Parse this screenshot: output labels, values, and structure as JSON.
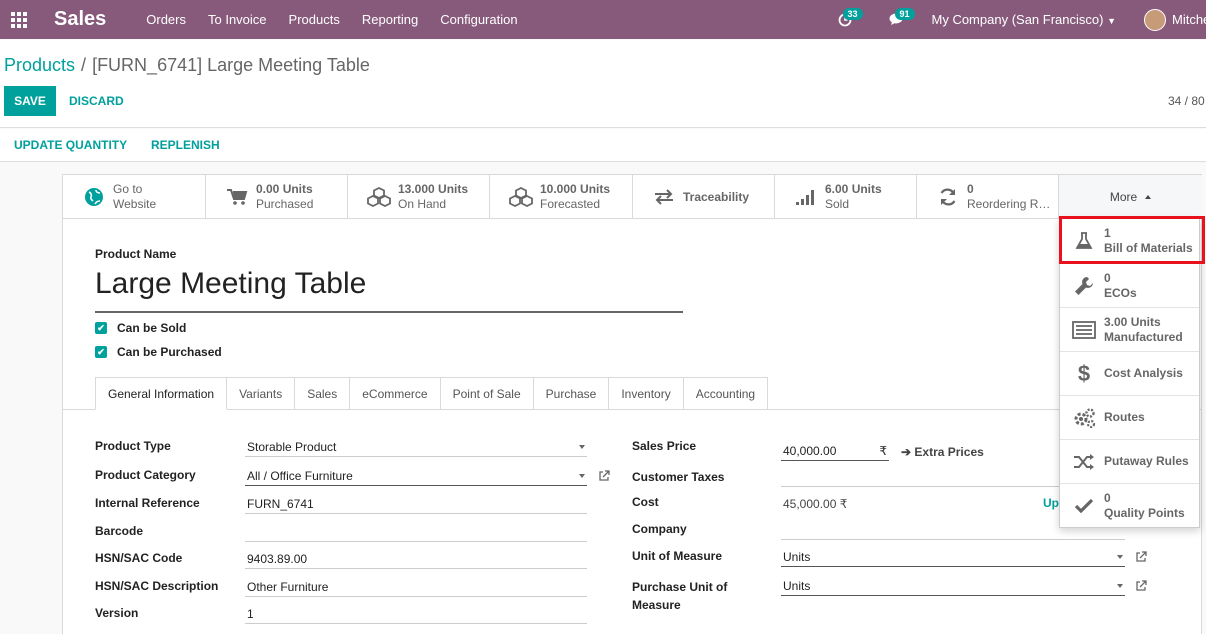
{
  "navbar": {
    "app_name": "Sales",
    "menu": [
      "Orders",
      "To Invoice",
      "Products",
      "Reporting",
      "Configuration"
    ],
    "activity_count": "33",
    "message_count": "91",
    "company": "My Company (San Francisco)",
    "user": "Mitchell Admin",
    "bg_color": "#875a7b"
  },
  "breadcrumb": {
    "parent": "Products",
    "separator": "/",
    "current": "[FURN_6741] Large Meeting Table"
  },
  "actions": {
    "save": "SAVE",
    "discard": "DISCARD",
    "pager": "34 / 80"
  },
  "status_buttons": {
    "update_quantity": "UPDATE QUANTITY",
    "replenish": "REPLENISH"
  },
  "smart_buttons": [
    {
      "line1": "Go to",
      "line2": "Website",
      "icon": "globe-icon"
    },
    {
      "line1": "0.00 Units",
      "line2": "Purchased",
      "icon": "cart-icon"
    },
    {
      "line1": "13.000 Units",
      "line2": "On Hand",
      "icon": "cubes-icon"
    },
    {
      "line1": "10.000 Units",
      "line2": "Forecasted",
      "icon": "cubes-icon"
    },
    {
      "line1": "Traceability",
      "line2": "",
      "icon": "arrows-icon"
    },
    {
      "line1": "6.00 Units",
      "line2": "Sold",
      "icon": "signal-icon"
    },
    {
      "line1": "0",
      "line2": "Reordering Rules",
      "icon": "refresh-icon"
    }
  ],
  "more_label": "More",
  "more_menu": [
    {
      "line1": "1",
      "line2": "Bill of Materials",
      "icon": "flask-icon"
    },
    {
      "line1": "0",
      "line2": "ECOs",
      "icon": "wrench-icon"
    },
    {
      "line1": "3.00 Units",
      "line2": "Manufactured",
      "icon": "list-icon"
    },
    {
      "line1": "Cost Analysis",
      "line2": "",
      "icon": "dollar-icon"
    },
    {
      "line1": "Routes",
      "line2": "",
      "icon": "cogs-icon"
    },
    {
      "line1": "Putaway Rules",
      "line2": "",
      "icon": "random-icon"
    },
    {
      "line1": "0",
      "line2": "Quality Points",
      "icon": "check-icon"
    }
  ],
  "product": {
    "name_label": "Product Name",
    "name": "Large Meeting Table",
    "can_be_sold": "Can be Sold",
    "can_be_purchased": "Can be Purchased"
  },
  "tabs": [
    "General Information",
    "Variants",
    "Sales",
    "eCommerce",
    "Point of Sale",
    "Purchase",
    "Inventory",
    "Accounting"
  ],
  "left_fields": {
    "product_type": {
      "label": "Product Type",
      "value": "Storable Product"
    },
    "product_category": {
      "label": "Product Category",
      "value": "All / Office Furniture"
    },
    "internal_reference": {
      "label": "Internal Reference",
      "value": "FURN_6741"
    },
    "barcode": {
      "label": "Barcode",
      "value": ""
    },
    "hsn_code": {
      "label": "HSN/SAC Code",
      "value": "9403.89.00"
    },
    "hsn_desc": {
      "label": "HSN/SAC Description",
      "value": "Other Furniture"
    },
    "version": {
      "label": "Version",
      "value": "1"
    }
  },
  "right_fields": {
    "sales_price": {
      "label": "Sales Price",
      "value": "40,000.00",
      "currency": "₹",
      "extra": "Extra Prices"
    },
    "customer_taxes": {
      "label": "Customer Taxes",
      "value": ""
    },
    "cost": {
      "label": "Cost",
      "value": "45,000.00 ₹",
      "link": "Up"
    },
    "company": {
      "label": "Company",
      "value": ""
    },
    "uom": {
      "label": "Unit of Measure",
      "value": "Units"
    },
    "purchase_uom": {
      "label": "Purchase Unit of Measure",
      "value": "Units"
    }
  }
}
